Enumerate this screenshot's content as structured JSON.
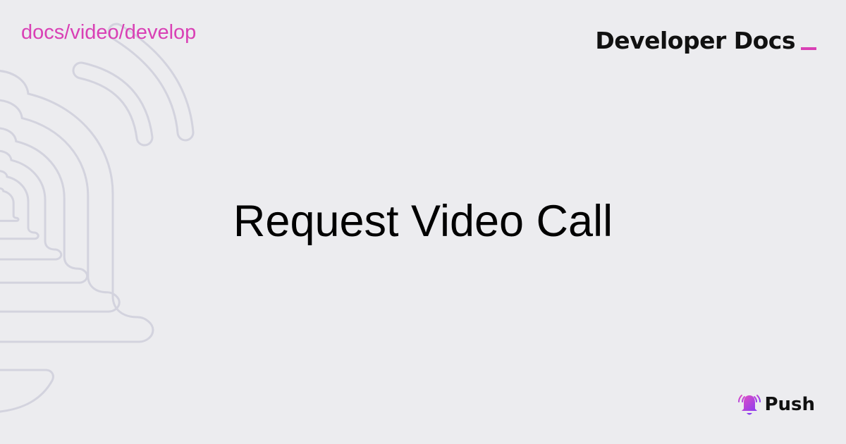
{
  "breadcrumb": "docs/video/develop",
  "brand": {
    "label": "Developer Docs",
    "accent": "#d940b5"
  },
  "title": "Request Video Call",
  "logo": {
    "name": "Push",
    "icon": "bell-icon"
  },
  "colors": {
    "background": "#ececef",
    "outline": "#d3d3de"
  }
}
